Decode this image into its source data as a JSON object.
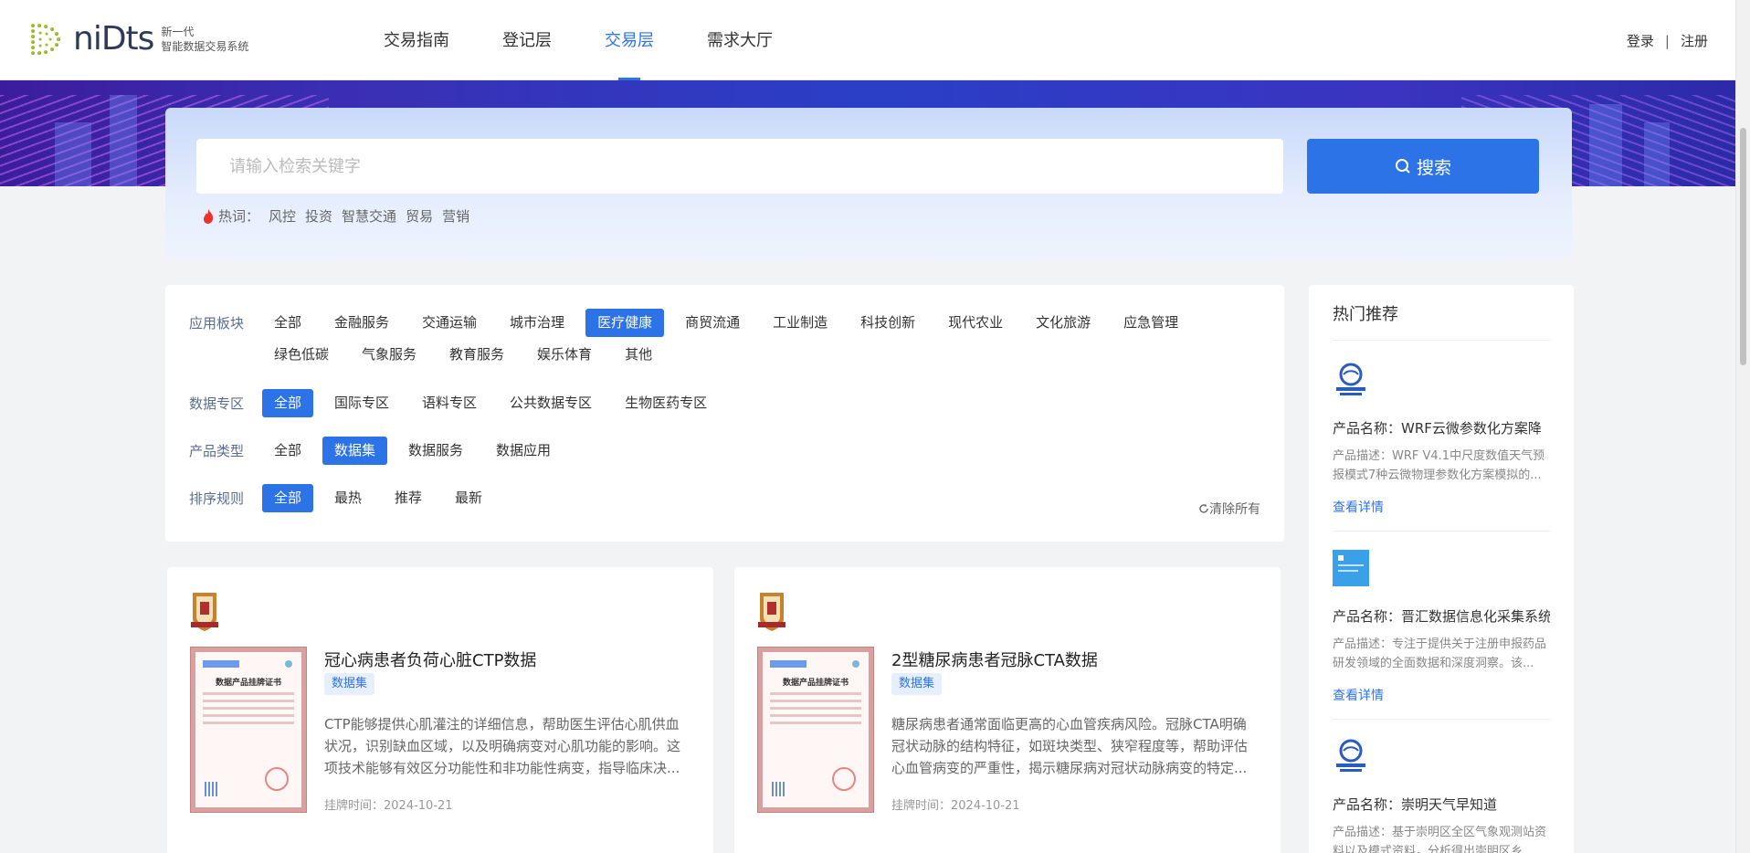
{
  "header": {
    "logo_word": "niDts",
    "logo_sub_line1": "新一代",
    "logo_sub_line2": "智能数据交易系统",
    "nav": [
      {
        "label": "交易指南",
        "active": false
      },
      {
        "label": "登记层",
        "active": false
      },
      {
        "label": "交易层",
        "active": true
      },
      {
        "label": "需求大厅",
        "active": false
      }
    ],
    "login": "登录",
    "separator": "|",
    "register": "注册"
  },
  "search": {
    "placeholder": "请输入检索关键字",
    "button_label": "搜索",
    "hot_label": "热词：",
    "hot_words": [
      "风控",
      "投资",
      "智慧交通",
      "贸易",
      "营销"
    ]
  },
  "filters": {
    "rows": [
      {
        "label": "应用板块",
        "options": [
          {
            "text": "全部",
            "selected": false
          },
          {
            "text": "金融服务",
            "selected": false
          },
          {
            "text": "交通运输",
            "selected": false
          },
          {
            "text": "城市治理",
            "selected": false
          },
          {
            "text": "医疗健康",
            "selected": true
          },
          {
            "text": "商贸流通",
            "selected": false
          },
          {
            "text": "工业制造",
            "selected": false
          },
          {
            "text": "科技创新",
            "selected": false
          },
          {
            "text": "现代农业",
            "selected": false
          },
          {
            "text": "文化旅游",
            "selected": false
          },
          {
            "text": "应急管理",
            "selected": false
          },
          {
            "text": "绿色低碳",
            "selected": false
          },
          {
            "text": "气象服务",
            "selected": false
          },
          {
            "text": "教育服务",
            "selected": false
          },
          {
            "text": "娱乐体育",
            "selected": false
          },
          {
            "text": "其他",
            "selected": false
          }
        ]
      },
      {
        "label": "数据专区",
        "options": [
          {
            "text": "全部",
            "selected": true
          },
          {
            "text": "国际专区",
            "selected": false
          },
          {
            "text": "语料专区",
            "selected": false
          },
          {
            "text": "公共数据专区",
            "selected": false
          },
          {
            "text": "生物医药专区",
            "selected": false
          }
        ]
      },
      {
        "label": "产品类型",
        "options": [
          {
            "text": "全部",
            "selected": false
          },
          {
            "text": "数据集",
            "selected": true
          },
          {
            "text": "数据服务",
            "selected": false
          },
          {
            "text": "数据应用",
            "selected": false
          }
        ]
      },
      {
        "label": "排序规则",
        "options": [
          {
            "text": "全部",
            "selected": true
          },
          {
            "text": "最热",
            "selected": false
          },
          {
            "text": "推荐",
            "selected": false
          },
          {
            "text": "最新",
            "selected": false
          }
        ]
      }
    ],
    "clear_all": "清除所有"
  },
  "products": [
    {
      "title": "冠心病患者负荷心脏CTP数据",
      "tag": "数据集",
      "description": "CTP能够提供心肌灌注的详细信息，帮助医生评估心肌供血状况，识别缺血区域，以及明确病变对心肌功能的影响。这项技术能够有效区分功能性和非功能性病变，指导临床决...",
      "listed_date": "挂牌时间：2024-10-21",
      "cert_title": "数据产品挂牌证书"
    },
    {
      "title": "2型糖尿病患者冠脉CTA数据",
      "tag": "数据集",
      "description": "糖尿病患者通常面临更高的心血管疾病风险。冠脉CTA明确冠状动脉的结构特征，如斑块类型、狭窄程度等，帮助评估心血管病变的严重性，揭示糖尿病对冠状动脉病变的特定...",
      "listed_date": "挂牌时间：2024-10-21",
      "cert_title": "数据产品挂牌证书"
    }
  ],
  "recommend": {
    "title": "热门推荐",
    "link_label": "查看详情",
    "items": [
      {
        "name": "产品名称：WRF云微参数化方案降",
        "desc": "产品描述：WRF V4.1中尺度数值天气预报模式7种云微物理参数化方案模拟的...",
        "logo": "weather-logo"
      },
      {
        "name": "产品名称：晋汇数据信息化采集系统",
        "desc": "产品描述：专注于提供关于注册申报药品研发领域的全面数据和深度洞察。该...",
        "logo": "app-logo"
      },
      {
        "name": "产品名称：崇明天气早知道",
        "desc": "产品描述：基于崇明区全区气象观测站资料以及模式资料，分析得出崇明区乡...",
        "logo": "weather-logo"
      }
    ]
  },
  "colors": {
    "accent": "#2d73e8",
    "tag_bg": "#e6efff"
  }
}
